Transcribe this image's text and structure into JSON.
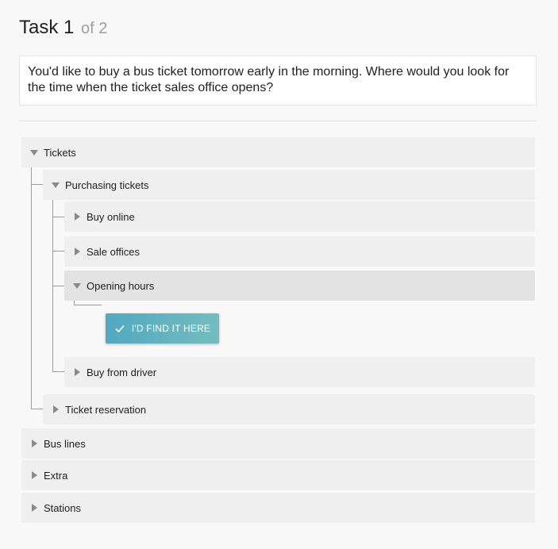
{
  "task": {
    "title": "Task 1",
    "counter": "of 2",
    "prompt": "You'd like to buy a bus ticket tomorrow early in the morning. Where would you look for the time when the ticket sales office opens?"
  },
  "tree": {
    "tickets": "Tickets",
    "purchasing_tickets": "Purchasing tickets",
    "buy_online": "Buy online",
    "sale_offices": "Sale offices",
    "opening_hours": "Opening hours",
    "find_button": "I'D FIND IT HERE",
    "buy_from_driver": "Buy from driver",
    "ticket_reservation": "Ticket reservation",
    "bus_lines": "Bus lines",
    "extra": "Extra",
    "stations": "Stations"
  },
  "icons": {
    "expanded": "triangle-down-icon",
    "collapsed": "triangle-right-icon",
    "confirm": "check-icon"
  },
  "colors": {
    "button_start": "#52a9c0",
    "button_end": "#74bcc0",
    "node_bg": "#efefef",
    "node_active_bg": "#e3e3e3"
  }
}
